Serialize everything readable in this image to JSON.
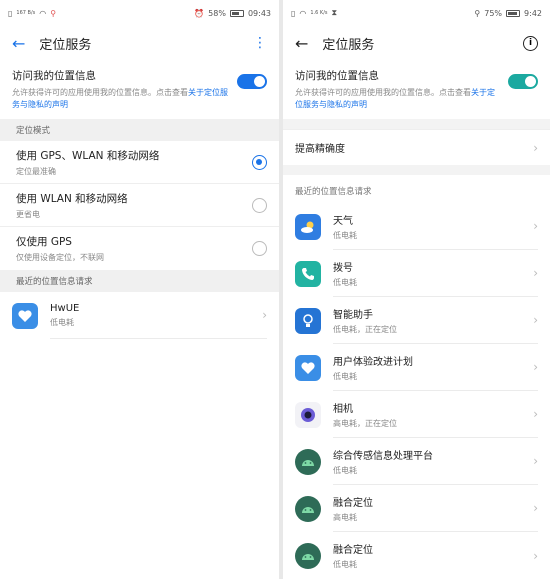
{
  "left": {
    "status": {
      "left": "167 B/s",
      "battery": "58%",
      "time": "09:43"
    },
    "title": "定位服务",
    "access": {
      "title": "访问我的位置信息",
      "desc": "允许获得许可的应用使用我的位置信息。点击查看",
      "link": "关于定位服务与隐私的声明"
    },
    "mode_header": "定位模式",
    "modes": [
      {
        "title": "使用 GPS、WLAN 和移动网络",
        "sub": "定位最准确",
        "selected": true
      },
      {
        "title": "使用 WLAN 和移动网络",
        "sub": "更省电",
        "selected": false
      },
      {
        "title": "仅使用 GPS",
        "sub": "仅使用设备定位，不联网",
        "selected": false
      }
    ],
    "recent_header": "最近的位置信息请求",
    "apps": [
      {
        "name": "HwUE",
        "sub": "低电耗",
        "icon": "hwue-icon",
        "color": "#3a8ee6"
      }
    ]
  },
  "right": {
    "status": {
      "left": "1.6 K/s",
      "battery": "75%",
      "time": "9:42"
    },
    "title": "定位服务",
    "access": {
      "title": "访问我的位置信息",
      "desc": "允许获得许可的应用使用我的位置信息。点击查看",
      "link": "关于定位服务与隐私的声明"
    },
    "accuracy_label": "提高精确度",
    "recent_header": "最近的位置信息请求",
    "apps": [
      {
        "name": "天气",
        "sub": "低电耗",
        "icon": "weather-icon",
        "color": "#2f7de1"
      },
      {
        "name": "拨号",
        "sub": "低电耗",
        "icon": "phone-icon",
        "color": "#22b3a2"
      },
      {
        "name": "智能助手",
        "sub": "低电耗，正在定位",
        "icon": "bulb-icon",
        "color": "#2574d4"
      },
      {
        "name": "用户体验改进计划",
        "sub": "低电耗",
        "icon": "hwue-icon",
        "color": "#3a8ee6"
      },
      {
        "name": "相机",
        "sub": "高电耗，正在定位",
        "icon": "camera-icon",
        "color": "#6b5cd6"
      },
      {
        "name": "综合传感信息处理平台",
        "sub": "低电耗",
        "icon": "android-icon",
        "color": "#2e6b57"
      },
      {
        "name": "融合定位",
        "sub": "高电耗",
        "icon": "android-icon",
        "color": "#2e6b57"
      },
      {
        "name": "融合定位",
        "sub": "低电耗",
        "icon": "android-icon",
        "color": "#2e6b57"
      }
    ]
  }
}
